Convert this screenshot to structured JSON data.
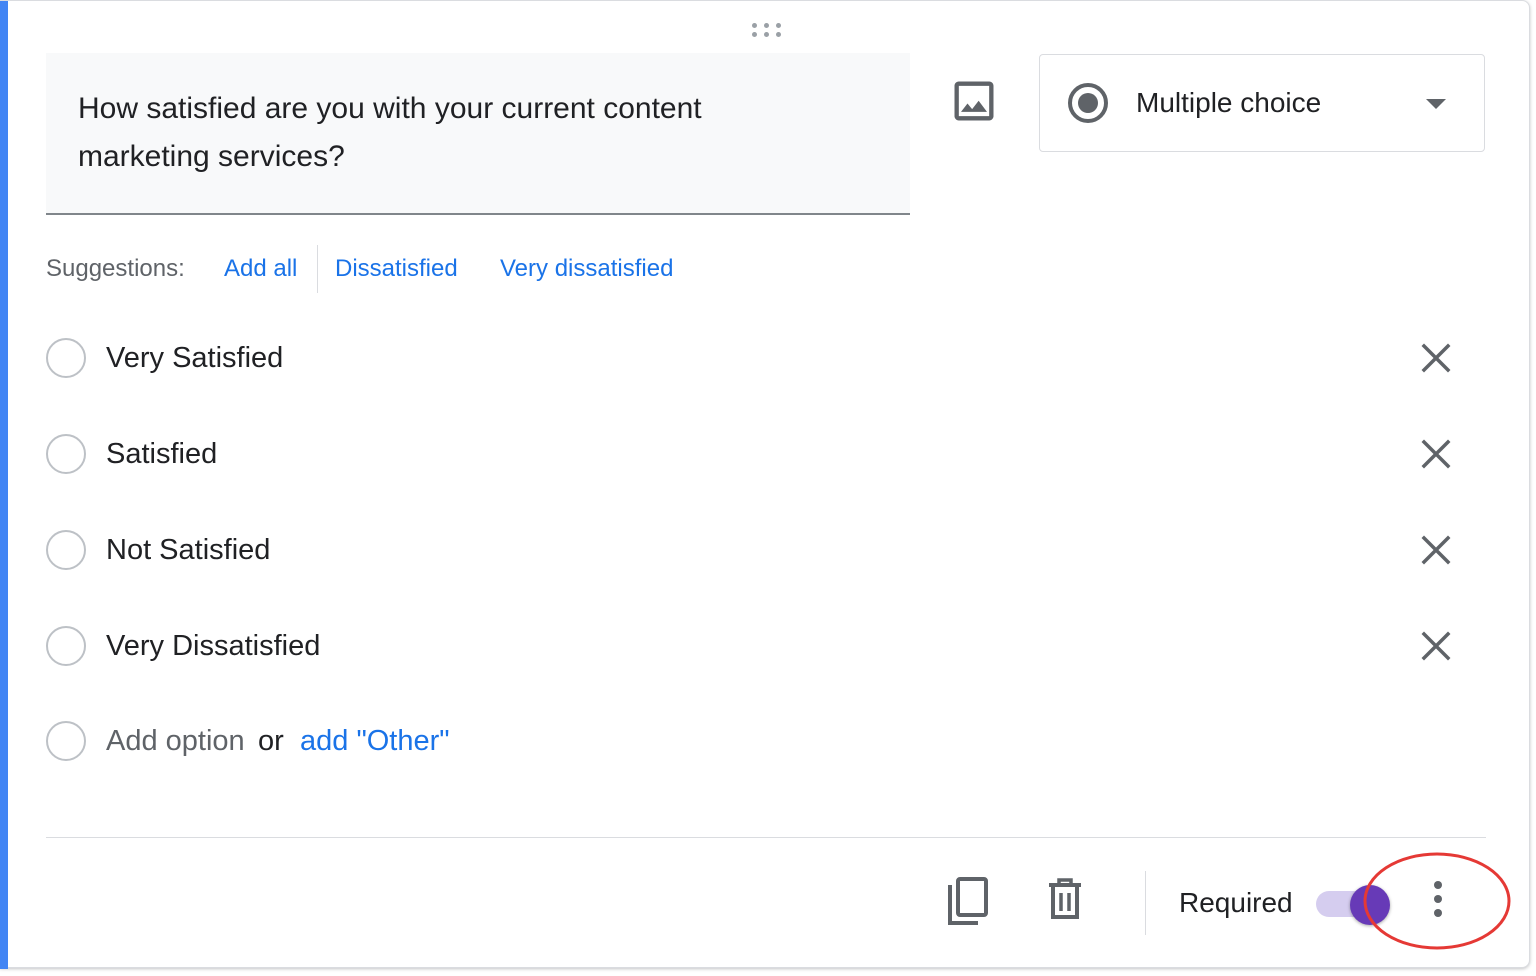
{
  "question": {
    "text": "How satisfied are you with your current content marketing services?"
  },
  "question_type": {
    "label": "Multiple choice",
    "icon": "radio-button-checked-icon"
  },
  "suggestions": {
    "label": "Suggestions:",
    "add_all": "Add all",
    "items": [
      "Dissatisfied",
      "Very dissatisfied"
    ]
  },
  "options": [
    {
      "label": "Very Satisfied"
    },
    {
      "label": "Satisfied"
    },
    {
      "label": "Not Satisfied"
    },
    {
      "label": "Very Dissatisfied"
    }
  ],
  "add_option": {
    "placeholder": "Add option",
    "or": "or",
    "add_other": "add \"Other\""
  },
  "footer": {
    "required_label": "Required",
    "required": true
  },
  "colors": {
    "accent_bar": "#4285f4",
    "link_blue": "#1a73e8",
    "toggle_thumb": "#673ab7",
    "toggle_track": "#d5cdef",
    "highlight_ring": "#e53935"
  }
}
